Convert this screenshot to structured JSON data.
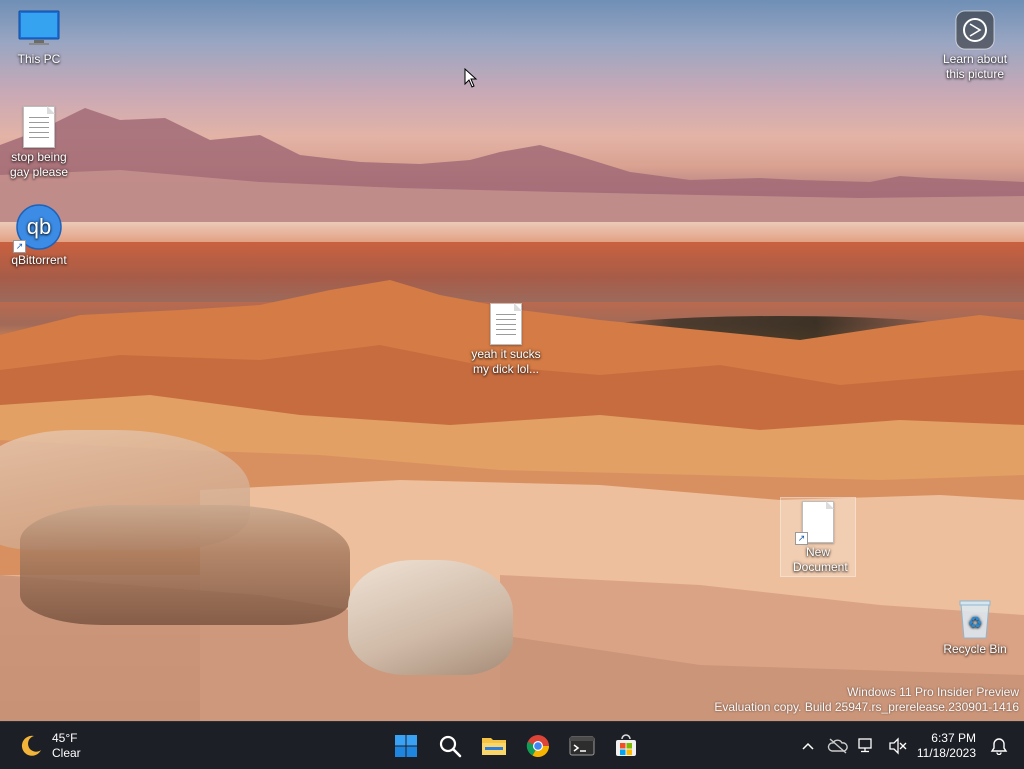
{
  "desktop": {
    "icons": [
      {
        "label": "This PC",
        "icon": "monitor-icon"
      },
      {
        "label": "stop being gay please",
        "icon": "text-document-icon"
      },
      {
        "label": "qBittorrent",
        "icon": "qbittorrent-icon"
      },
      {
        "label": "yeah it sucks my dick lol...",
        "icon": "text-document-icon"
      },
      {
        "label": "New Document",
        "icon": "blank-document-icon"
      },
      {
        "label": "Recycle Bin",
        "icon": "recycle-bin-icon"
      },
      {
        "label": "Learn about this picture",
        "icon": "camera-icon"
      }
    ],
    "watermark": {
      "line1": "Windows 11 Pro Insider Preview",
      "line2": "Evaluation copy. Build 25947.rs_prerelease.230901-1416"
    }
  },
  "taskbar": {
    "weather": {
      "temp": "45°F",
      "condition": "Clear",
      "icon": "moon-icon"
    },
    "pinned": [
      {
        "name": "Start",
        "icon": "windows-logo-icon"
      },
      {
        "name": "Search",
        "icon": "search-icon"
      },
      {
        "name": "File Explorer",
        "icon": "folder-icon"
      },
      {
        "name": "Google Chrome",
        "icon": "chrome-icon"
      },
      {
        "name": "Terminal",
        "icon": "terminal-icon"
      },
      {
        "name": "Microsoft Store",
        "icon": "store-icon"
      }
    ],
    "tray": {
      "time": "6:37 PM",
      "date": "11/18/2023"
    }
  },
  "colors": {
    "taskbar_bg": "#1c1f26",
    "accent": "#0078d4"
  }
}
